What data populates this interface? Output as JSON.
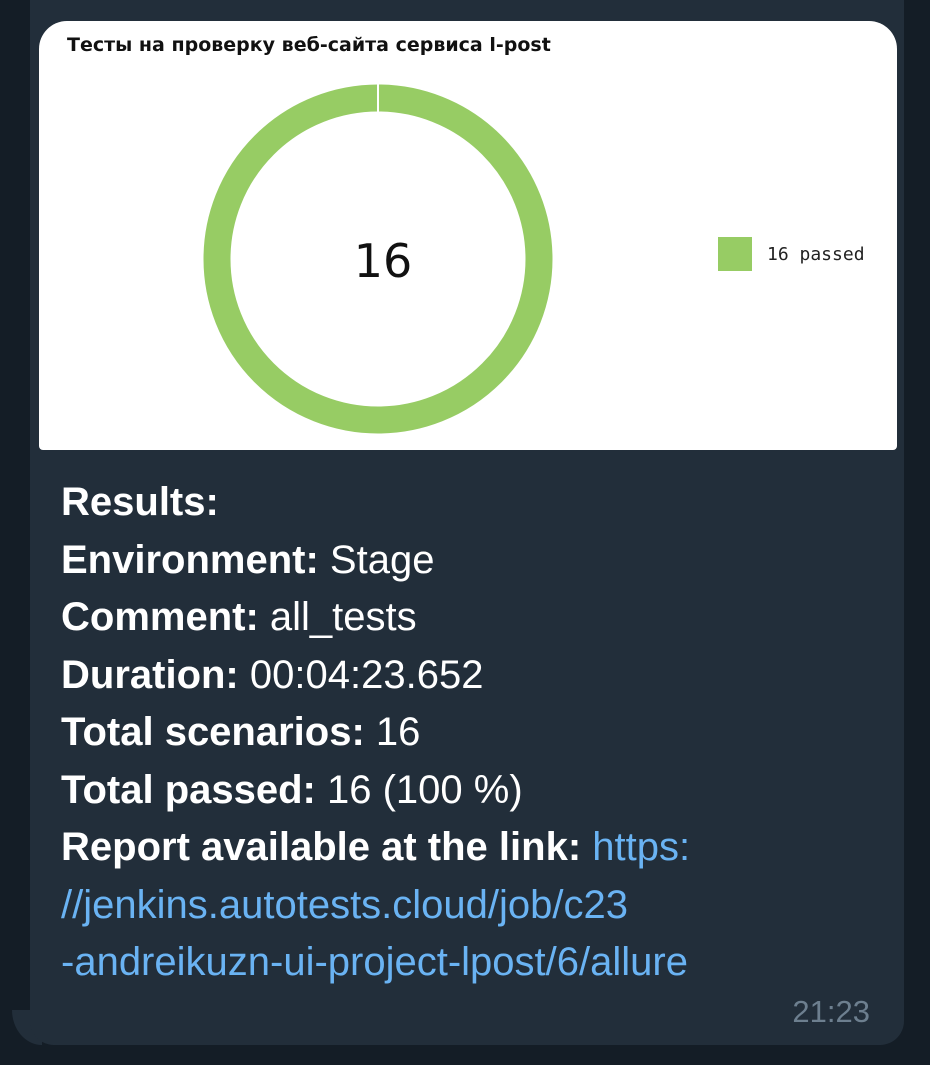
{
  "chart_data": {
    "type": "pie",
    "title": "Тесты на проверку веб-сайта сервиса l-post",
    "center_label": "16",
    "slices": [
      {
        "name": "16 passed",
        "value": 16,
        "color": "#97cc64"
      }
    ],
    "legend": [
      "16 passed"
    ],
    "legend_position": "right"
  },
  "message": {
    "results_label": "Results:",
    "environment_label": "Environment:",
    "environment_value": "Stage",
    "comment_label": "Comment:",
    "comment_value": "all_tests",
    "duration_label": "Duration:",
    "duration_value": "00:04:23.652",
    "total_scenarios_label": "Total scenarios:",
    "total_scenarios_value": "16",
    "total_passed_label": "Total passed:",
    "total_passed_value": "16 (100 %)",
    "report_label": "Report available at the link:",
    "report_link_part1": "https:",
    "report_link_part2": "//jenkins.autotests.cloud/job/c23",
    "report_link_part3": "-andreikuzn-ui-project-lpost/6/allure",
    "time": "21:23"
  },
  "colors": {
    "bubble": "#222e3a",
    "link": "#6ab3f3",
    "passed": "#97cc64"
  }
}
